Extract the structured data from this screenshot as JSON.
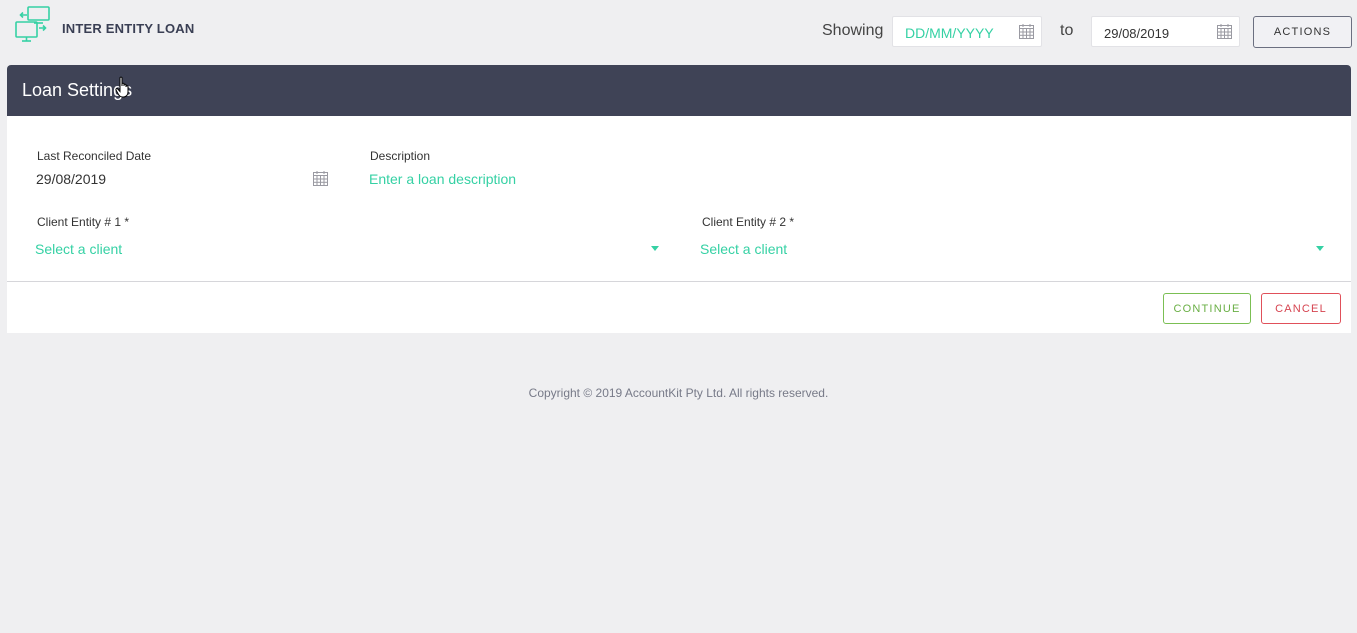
{
  "header": {
    "title": "INTER ENTITY LOAN",
    "logo_icon": "transfer-devices-icon",
    "showing_label": "Showing",
    "from_date": {
      "placeholder": "DD/MM/YYYY",
      "value": ""
    },
    "to_label": "to",
    "to_date": {
      "value": "29/08/2019"
    },
    "actions_label": "ACTIONS"
  },
  "card": {
    "title": "Loan Settings",
    "last_reconciled": {
      "label": "Last Reconciled Date",
      "value": "29/08/2019"
    },
    "description": {
      "label": "Description",
      "placeholder": "Enter a loan description"
    },
    "client1": {
      "label": "Client Entity # 1 *",
      "placeholder": "Select a client"
    },
    "client2": {
      "label": "Client Entity # 2 *",
      "placeholder": "Select a client"
    },
    "continue_label": "CONTINUE",
    "cancel_label": "CANCEL"
  },
  "footer": {
    "copyright": "Copyright © 2019 AccountKit Pty Ltd. All rights reserved."
  },
  "colors": {
    "accent": "#35d1a4",
    "header_bg": "#3f4356",
    "continue": "#7bbf54",
    "cancel": "#e0505a"
  }
}
